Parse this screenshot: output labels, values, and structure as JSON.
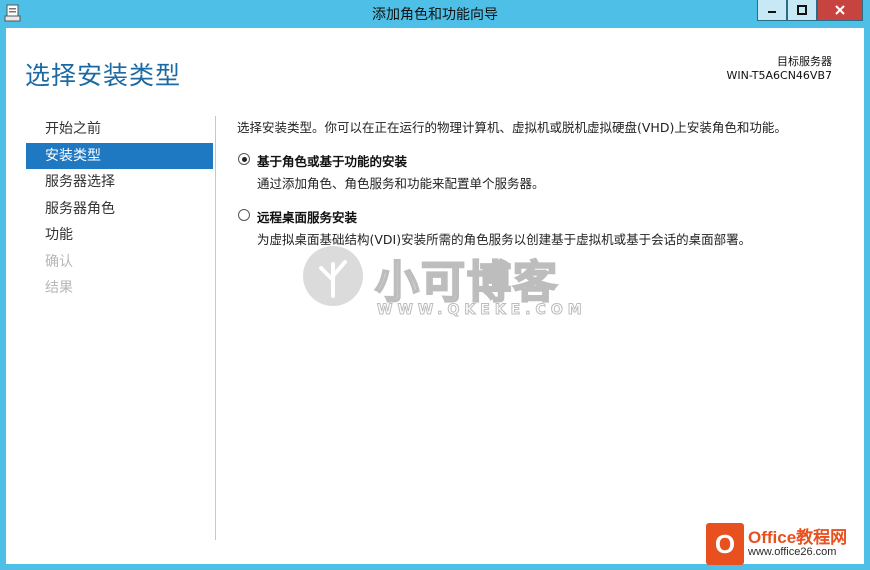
{
  "window": {
    "title": "添加角色和功能向导"
  },
  "header": {
    "page_title": "选择安装类型",
    "target_server_label": "目标服务器",
    "target_server_name": "WIN-T5A6CN46VB7"
  },
  "nav": {
    "items": [
      {
        "label": "开始之前",
        "state": "normal"
      },
      {
        "label": "安装类型",
        "state": "selected"
      },
      {
        "label": "服务器选择",
        "state": "normal"
      },
      {
        "label": "服务器角色",
        "state": "normal"
      },
      {
        "label": "功能",
        "state": "normal"
      },
      {
        "label": "确认",
        "state": "disabled"
      },
      {
        "label": "结果",
        "state": "disabled"
      }
    ]
  },
  "content": {
    "intro": "选择安装类型。你可以在正在运行的物理计算机、虚拟机或脱机虚拟硬盘(VHD)上安装角色和功能。",
    "options": [
      {
        "title": "基于角色或基于功能的安装",
        "description": "通过添加角色、角色服务和功能来配置单个服务器。",
        "selected": true
      },
      {
        "title": "远程桌面服务安装",
        "description": "为虚拟桌面基础结构(VDI)安装所需的角色服务以创建基于虚拟机或基于会话的桌面部署。",
        "selected": false
      }
    ]
  },
  "watermark": {
    "name": "小可博客",
    "url": "WWW.QKEKE.COM"
  },
  "badge": {
    "name": "Office教程网",
    "url": "www.office26.com"
  },
  "colors": {
    "titlebar": "#4ec0e8",
    "accent": "#1f78c2",
    "page_title": "#1b6aa3",
    "close_button": "#c7433f"
  }
}
